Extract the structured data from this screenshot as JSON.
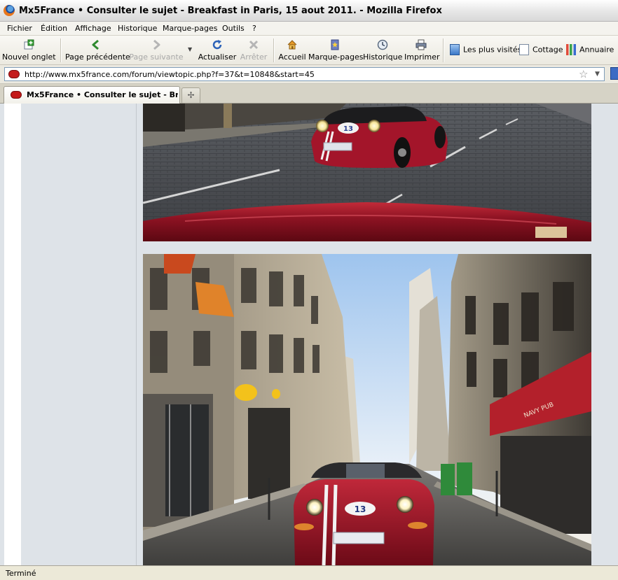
{
  "window": {
    "title": "Mx5France • Consulter le sujet - Breakfast in Paris, 15 aout 2011. - Mozilla Firefox"
  },
  "menu": [
    "Fichier",
    "Édition",
    "Affichage",
    "Historique",
    "Marque-pages",
    "Outils",
    "?"
  ],
  "toolbar": {
    "new_tab": "Nouvel onglet",
    "back": "Page précédente",
    "forward": "Page suivante",
    "reload": "Actualiser",
    "stop": "Arrêter",
    "home": "Accueil",
    "bookmarks": "Marque-pages",
    "history": "Historique",
    "print": "Imprimer"
  },
  "bookmarks_bar": [
    "Les plus visités",
    "Cottage",
    "Annuaire"
  ],
  "address_bar": {
    "url": "http://www.mx5france.com/forum/viewtopic.php?f=37&t=10848&start=45"
  },
  "tabs": [
    {
      "label": "Mx5France • Consulter le sujet - Bre...",
      "active": true
    }
  ],
  "content": {
    "photos": [
      {
        "car_number": "13",
        "plate": ""
      },
      {
        "car_number": "13",
        "shop_sign": "NAVY PUB"
      }
    ]
  },
  "status": {
    "text": "Terminé"
  },
  "colors": {
    "car_red": "#a3152a",
    "page_bg": "#dee3e8",
    "sky": "#e5eef7",
    "stone": "#b8aa93"
  }
}
